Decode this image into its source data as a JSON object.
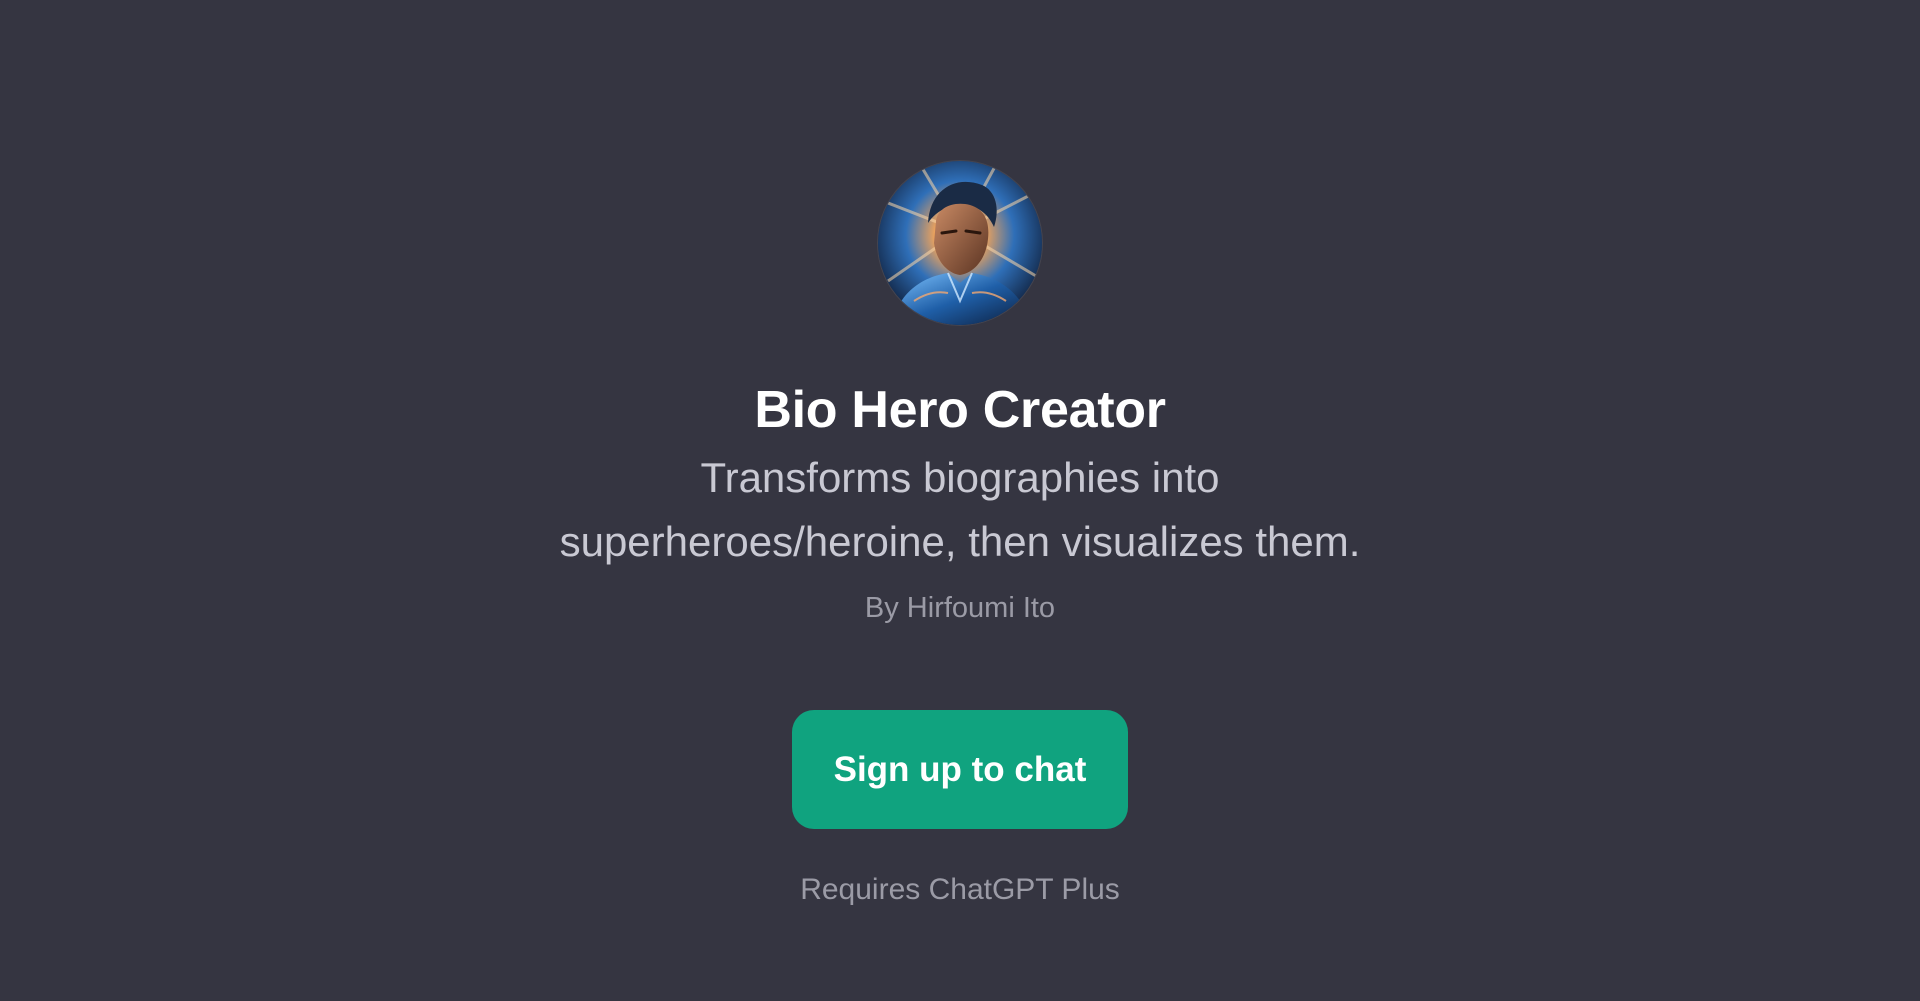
{
  "gpt": {
    "avatar_icon": "superhero-portrait-avatar",
    "name": "Bio Hero Creator",
    "description_line1": "Transforms biographies into",
    "description_line2": "superheroes/heroine, then visualizes them.",
    "author": "By Hirfoumi Ito"
  },
  "cta": {
    "signup_label": "Sign up to chat",
    "requirement": "Requires ChatGPT Plus"
  },
  "colors": {
    "background": "#353541",
    "accent": "#10a37f",
    "title": "#ffffff",
    "description": "#c9c9d3",
    "muted": "#9b9ba6"
  }
}
